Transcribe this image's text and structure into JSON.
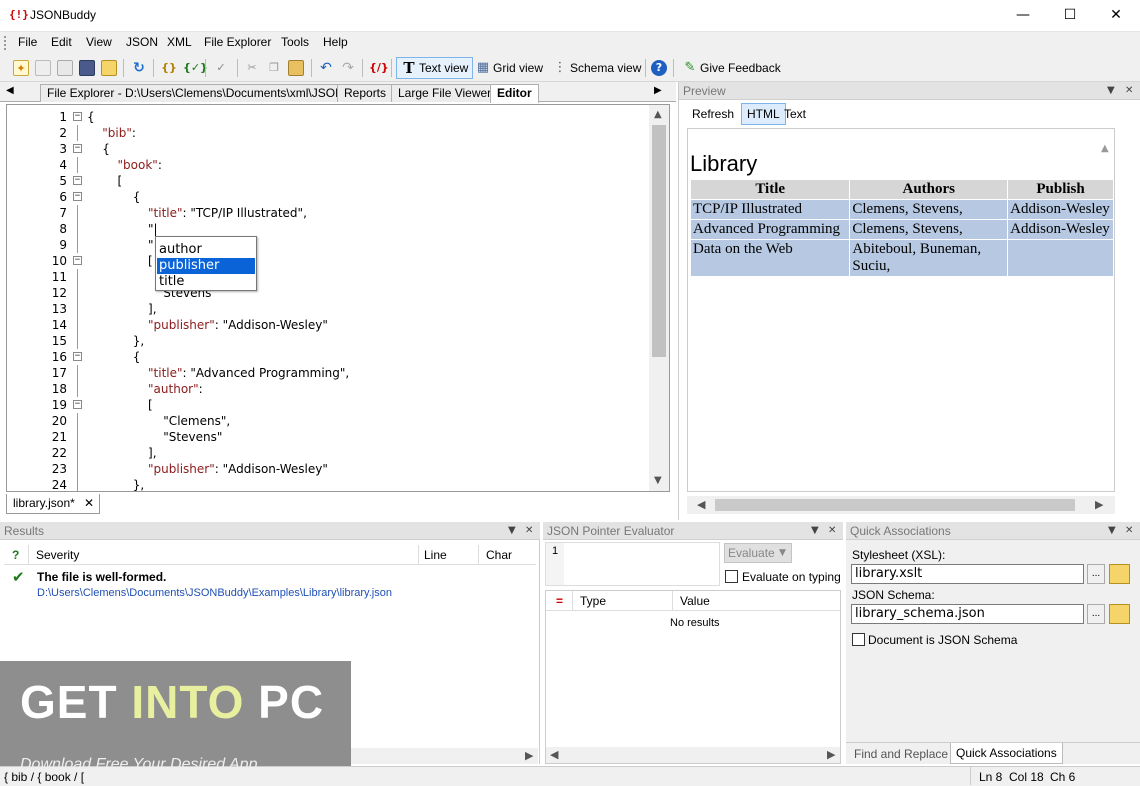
{
  "window": {
    "app_icon": "{!}",
    "title": "JSONBuddy",
    "controls": {
      "minimize": "—",
      "maximize": "☐",
      "close": "✕"
    }
  },
  "menu": [
    "File",
    "Edit",
    "View",
    "JSON",
    "XML",
    "File Explorer",
    "Tools",
    "Help"
  ],
  "toolbar": {
    "text_view": "Text view",
    "grid_view": "Grid view",
    "schema_view": "Schema view",
    "give_feedback": "Give Feedback"
  },
  "doc_tabs": [
    {
      "label": "File Explorer - D:\\Users\\Clemens\\Documents\\xml\\JSON",
      "active": false
    },
    {
      "label": "Reports",
      "active": false
    },
    {
      "label": "Large File Viewer",
      "active": false
    },
    {
      "label": "Editor",
      "active": true
    }
  ],
  "editor": {
    "lines": [
      {
        "n": "1",
        "text": "{"
      },
      {
        "n": "2",
        "text": "    \"bib\":"
      },
      {
        "n": "3",
        "text": "    {"
      },
      {
        "n": "4",
        "text": "        \"book\":"
      },
      {
        "n": "5",
        "text": "        ["
      },
      {
        "n": "6",
        "text": "            {"
      },
      {
        "n": "7",
        "text": "                \"title\": \"TCP/IP Illustrated\","
      },
      {
        "n": "8",
        "text": "                \"|"
      },
      {
        "n": "9",
        "text": "                \""
      },
      {
        "n": "10",
        "text": "                ["
      },
      {
        "n": "11",
        "text": "                    "
      },
      {
        "n": "12",
        "text": "                    Stevens"
      },
      {
        "n": "13",
        "text": "                ],"
      },
      {
        "n": "14",
        "text": "                \"publisher\": \"Addison-Wesley\""
      },
      {
        "n": "15",
        "text": "            },"
      },
      {
        "n": "16",
        "text": "            {"
      },
      {
        "n": "17",
        "text": "                \"title\": \"Advanced Programming\","
      },
      {
        "n": "18",
        "text": "                \"author\":"
      },
      {
        "n": "19",
        "text": "                ["
      },
      {
        "n": "20",
        "text": "                    \"Clemens\","
      },
      {
        "n": "21",
        "text": "                    \"Stevens\""
      },
      {
        "n": "22",
        "text": "                ],"
      },
      {
        "n": "23",
        "text": "                \"publisher\": \"Addison-Wesley\""
      },
      {
        "n": "24",
        "text": "            },"
      }
    ],
    "autocomplete": [
      "author",
      "publisher",
      "title"
    ],
    "autocomplete_selected": "publisher",
    "file_tab": "library.json*",
    "file_tab_close": "✕"
  },
  "preview": {
    "title": "Preview",
    "buttons": [
      "Refresh",
      "HTML",
      "Text"
    ],
    "active_button": "HTML",
    "heading": "Library",
    "table": {
      "headers": [
        "Title",
        "Authors",
        "Publish"
      ],
      "rows": [
        [
          "TCP/IP Illustrated",
          "Clemens, Stevens,",
          "Addison-Wesley"
        ],
        [
          "Advanced Programming",
          "Clemens, Stevens,",
          "Addison-Wesley"
        ],
        [
          "Data on the Web",
          "Abiteboul, Buneman, Suciu,",
          ""
        ]
      ]
    }
  },
  "results": {
    "title": "Results",
    "columns": [
      "?",
      "Severity",
      "Line",
      "Char"
    ],
    "message": "The file is well-formed.",
    "path": "D:\\Users\\Clemens\\Documents\\JSONBuddy\\Examples\\Library\\library.json"
  },
  "json_pointer": {
    "title": "JSON Pointer Evaluator",
    "line_number": "1",
    "evaluate_button": "Evaluate",
    "evaluate_on_typing": "Evaluate on typing",
    "columns": [
      "=",
      "Type",
      "Value"
    ],
    "empty": "No results"
  },
  "quick_associations": {
    "title": "Quick Associations",
    "stylesheet_label": "Stylesheet (XSL):",
    "stylesheet_value": "library.xslt",
    "schema_label": "JSON Schema:",
    "schema_value": "library_schema.json",
    "doc_is_schema": "Document is JSON Schema",
    "browse": "...",
    "bottom_tabs": [
      "Find and Replace",
      "Quick Associations"
    ],
    "active_tab": "Quick Associations"
  },
  "statusbar": {
    "path": "{ bib / { book / [",
    "ln": "Ln 8",
    "col": "Col 18",
    "ch": "Ch 6"
  },
  "watermark": {
    "get": "GET ",
    "into": "INTO",
    "pc": " PC",
    "subtitle": "Download Free Your Desired App"
  },
  "colors": {
    "selection": "#0a64d8",
    "key": "#8b1a1a",
    "table_cell": "#b7c9e2",
    "table_header": "#d6d6d6",
    "path_link": "#1f4fb5",
    "ok_check": "#1a7a1a"
  }
}
